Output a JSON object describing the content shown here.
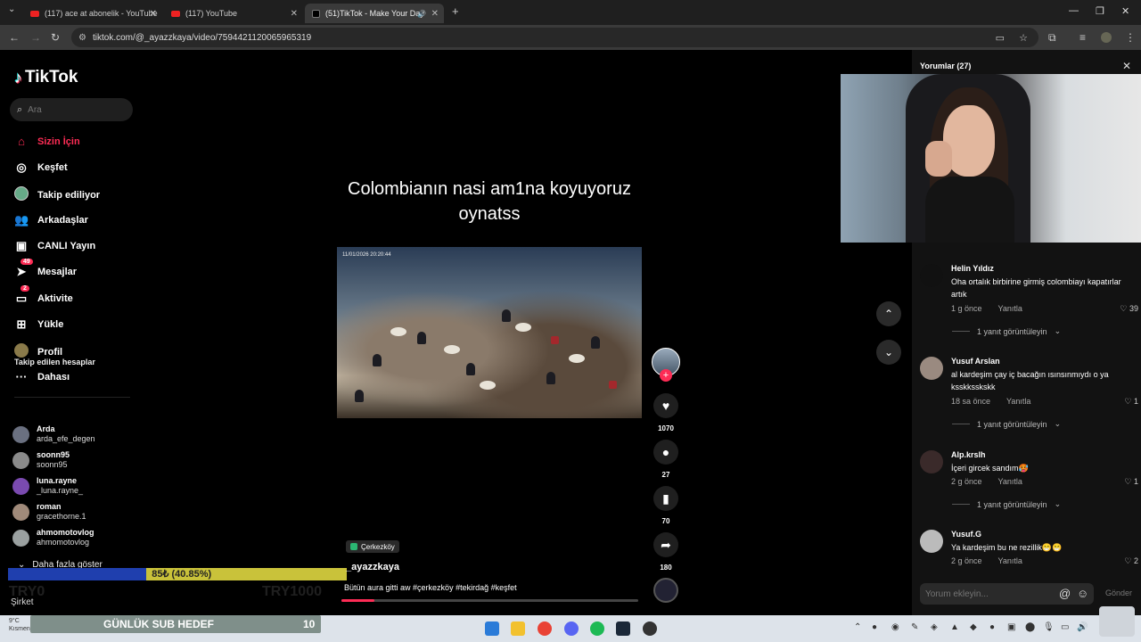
{
  "browser": {
    "tabs": [
      {
        "title": "(117) ace at abonelik - YouTube",
        "icon": "youtube-icon"
      },
      {
        "title": "(117) YouTube",
        "icon": "youtube-icon"
      },
      {
        "title": "(51)TikTok - Make Your Day",
        "icon": "tiktok-icon",
        "active": true
      }
    ],
    "url": "tiktok.com/@_ayazzkaya/video/7594421120065965319"
  },
  "sidebar": {
    "logo": "TikTok",
    "search_placeholder": "Ara",
    "nav": [
      {
        "label": "Sizin İçin",
        "icon": "home-icon",
        "active": true
      },
      {
        "label": "Keşfet",
        "icon": "compass-icon"
      },
      {
        "label": "Takip ediliyor",
        "icon": "following-avatar-icon"
      },
      {
        "label": "Arkadaşlar",
        "icon": "friends-icon"
      },
      {
        "label": "CANLI Yayın",
        "icon": "live-icon"
      },
      {
        "label": "Mesajlar",
        "icon": "messages-icon",
        "badge": "49"
      },
      {
        "label": "Aktivite",
        "icon": "activity-icon",
        "badge": "2"
      },
      {
        "label": "Yükle",
        "icon": "upload-icon"
      },
      {
        "label": "Profil",
        "icon": "profile-avatar-icon"
      },
      {
        "label": "Dahası",
        "icon": "more-icon"
      }
    ],
    "following_header": "Takip edilen hesaplar",
    "following": [
      {
        "name": "Arda",
        "handle": "arda_efe_degen"
      },
      {
        "name": "soonn95",
        "handle": "soonn95"
      },
      {
        "name": "luna.rayne",
        "handle": "_luna.rayne_"
      },
      {
        "name": "roman",
        "handle": "gracethorne.1"
      },
      {
        "name": "ahmomotovlog",
        "handle": "ahmomotovlog"
      }
    ],
    "show_more": "Daha fazla göster",
    "company": "Şirket"
  },
  "video": {
    "title": "Colombianın nasi am1na koyuyoruz oynatss",
    "timestamp": "11/01/2026 20:20:44",
    "location": "Çerkezköy",
    "author": "_ayazzkaya",
    "description": "Bütün aura gitti aw #çerkezköy #tekirdağ #keşfet",
    "progress": 0.11
  },
  "actions": {
    "likes": "1070",
    "comments": "27",
    "saves": "70",
    "shares": "180"
  },
  "comments_panel": {
    "title": "Yorumlar",
    "count": "(27)",
    "comments": [
      {
        "name": "Helin Yıldız",
        "text": "Oha ortalık birbirine girmiş colombiayı kapatırlar artık",
        "time": "1 g önce",
        "reply": "Yanıtla",
        "likes": "39",
        "replies": "1 yanıt görüntüleyin"
      },
      {
        "name": "Yusuf Arslan",
        "text": "al kardeşim çay iç bacağın ısınsınmıydı o ya ksskksskskk",
        "time": "18 sa önce",
        "reply": "Yanıtla",
        "likes": "1",
        "replies": "1 yanıt görüntüleyin"
      },
      {
        "name": "Alp.krslh",
        "text": "İçeri gircek sandım🥵",
        "time": "2 g önce",
        "reply": "Yanıtla",
        "likes": "1",
        "replies": "1 yanıt görüntüleyin"
      },
      {
        "name": "Yusuf.G",
        "text": "Ya kardeşim bu ne rezillik😁😁",
        "time": "2 g önce",
        "reply": "Yanıtla",
        "likes": "2"
      }
    ],
    "input_placeholder": "Yorum ekleyin...",
    "send": "Gönder"
  },
  "stream_overlay": {
    "progress_text": "85₺ (40.85%)",
    "progress": 0.4085,
    "goal_label": "GÜNLÜK SUB HEDEF",
    "goal_value": "10",
    "faint_left": "TRY0",
    "faint_right": "TRY1000"
  },
  "taskbar": {
    "temp": "9°C",
    "weather": "Kısmen güneşli"
  },
  "colors": {
    "accent": "#fe2c55",
    "goal_bar": "#c9c23a",
    "goal_fill": "#1f3fae"
  }
}
